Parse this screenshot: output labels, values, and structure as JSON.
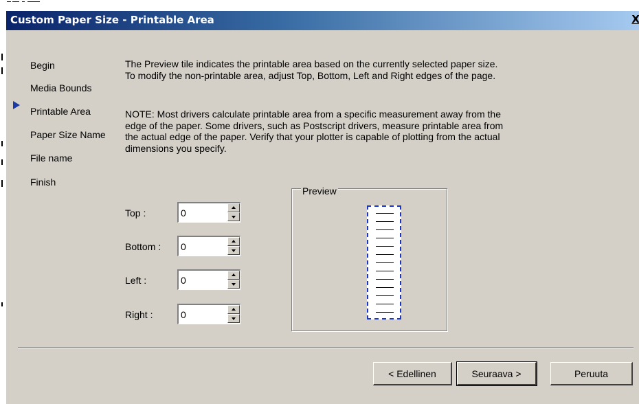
{
  "window": {
    "title": "Custom Paper Size - Printable Area",
    "close_glyph": "X"
  },
  "steps": [
    {
      "label": "Begin",
      "active": false
    },
    {
      "label": "Media Bounds",
      "active": false
    },
    {
      "label": "Printable Area",
      "active": true
    },
    {
      "label": "Paper Size Name",
      "active": false
    },
    {
      "label": "File name",
      "active": false
    },
    {
      "label": "Finish",
      "active": false
    }
  ],
  "description": {
    "intro": "The Preview tile indicates the printable area based on the currently selected paper size. To modify the non-printable area, adjust Top, Bottom, Left and Right edges of the page.",
    "note": "NOTE: Most drivers calculate printable area from a specific measurement away from the edge of the paper. Some drivers, such as Postscript drivers, measure printable area from the actual edge of the paper. Verify that your plotter is capable of plotting from the actual dimensions you specify."
  },
  "fields": {
    "top": {
      "label": "Top :",
      "value": "0"
    },
    "bottom": {
      "label": "Bottom :",
      "value": "0"
    },
    "left": {
      "label": "Left :",
      "value": "0"
    },
    "right": {
      "label": "Right :",
      "value": "0"
    }
  },
  "preview": {
    "label": "Preview"
  },
  "buttons": {
    "back": "< Edellinen",
    "next": "Seuraava >",
    "cancel": "Peruuta"
  },
  "colors": {
    "active_arrow": "#1c3ba6",
    "paper_border": "#1a35c8",
    "dialog_bg": "#d4d0c8"
  }
}
